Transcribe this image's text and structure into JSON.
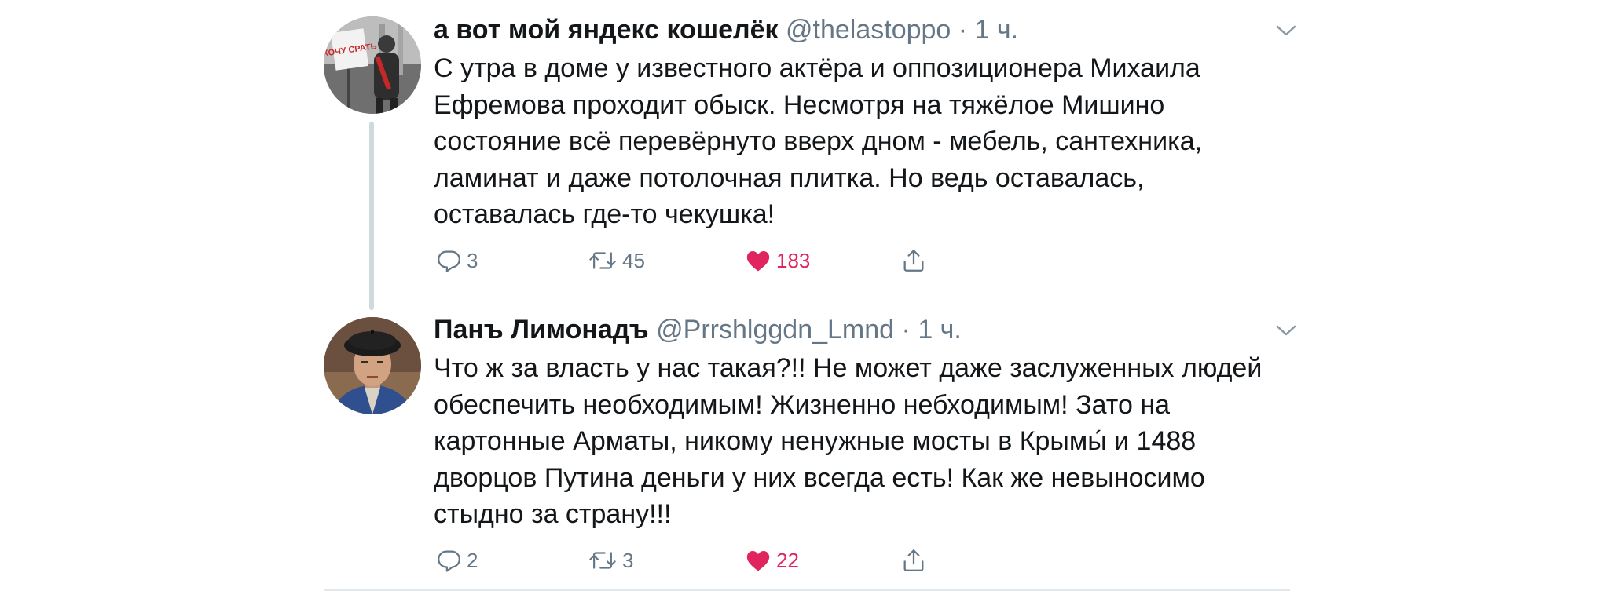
{
  "tweets": [
    {
      "name": "а вот мой яндекс кошелёк",
      "handle": "@thelastoppo",
      "dot": "·",
      "time": "1 ч.",
      "avatar_sign_text": "ХОЧУ СРАТЬ",
      "lines": [
        "С утра в доме у известного актёра и оппозиционера Михаила",
        "Ефремова проходит обыск. Несмотря на тяжёлое Мишино",
        "состояние всё перевёрнуто вверх дном - мебель, сантехника,",
        "ламинат и даже потолочная плитка. Но ведь оставалась,",
        "оставалась где-то чекушка!"
      ],
      "replies": "3",
      "retweets": "45",
      "likes": "183"
    },
    {
      "name": "Панъ Лимонадъ",
      "handle": "@Prrshlggdn_Lmnd",
      "dot": "·",
      "time": "1 ч.",
      "lines": [
        "Что ж за власть у нас такая?!! Не может даже заслуженных людей",
        "обеспечить необходимым! Жизненно небходимым! Зато на",
        "картонные Арматы, никому ненужные мосты в Крымы́ и 1488",
        "дворцов Путина деньги у них всегда есть! Как же невыносимо",
        "стыдно за страну!!!"
      ],
      "replies": "2",
      "retweets": "3",
      "likes": "22"
    }
  ],
  "icons": {
    "reply": "reply-icon",
    "retweet": "retweet-icon",
    "like": "heart-icon",
    "share": "share-icon",
    "menu": "chevron-down-icon"
  },
  "colors": {
    "text": "#14171a",
    "secondary": "#657786",
    "like": "#e0245e",
    "thread_line": "#cfd9de",
    "divider": "#e1e8ed"
  }
}
